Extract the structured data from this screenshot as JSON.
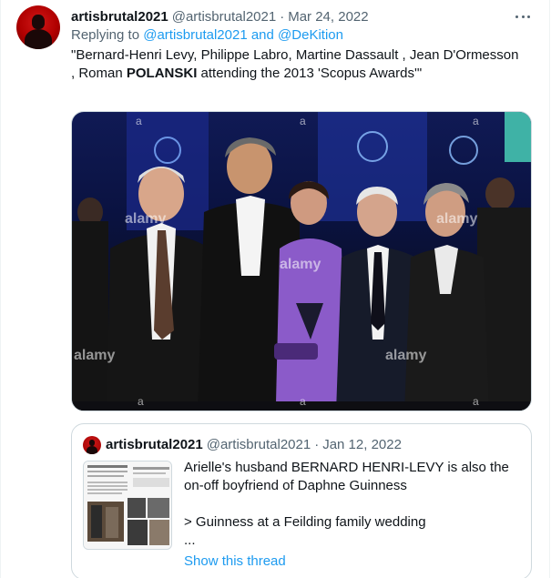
{
  "tweet": {
    "display_name": "artisbrutal2021",
    "handle": "@artisbrutal2021",
    "separator": "·",
    "date": "Mar 24, 2022",
    "replying_to_prefix": "Replying to",
    "replying_to_mentions": "@artisbrutal2021 and @DeKition",
    "text_lines": {
      "l1": "\"Bernard-Henri Levy, Philippe Labro, Martine Dassault , Jean D'Ormesson",
      "l2_start": ", Roman ",
      "l2_bold": "POLANSKI",
      "l2_end": " attending the 2013 'Scopus Awards'\""
    },
    "photo_watermark": "alamy",
    "photo_watermark_letter": "a"
  },
  "quote": {
    "display_name": "artisbrutal2021",
    "handle": "@artisbrutal2021",
    "separator": "·",
    "date": "Jan 12, 2022",
    "lines": [
      "Arielle's husband BERNARD HENRI-LEVY is also the",
      "on-off boyfriend of Daphne Guinness",
      "> Guinness at a Feilding family wedding",
      "..."
    ],
    "show_thread": "Show this thread"
  },
  "icons": {
    "more": "more-horizontal-icon"
  },
  "colors": {
    "link": "#1d9bf0",
    "secondary_text": "#536471",
    "primary_text": "#0f1419",
    "border": "#cfd9de"
  }
}
